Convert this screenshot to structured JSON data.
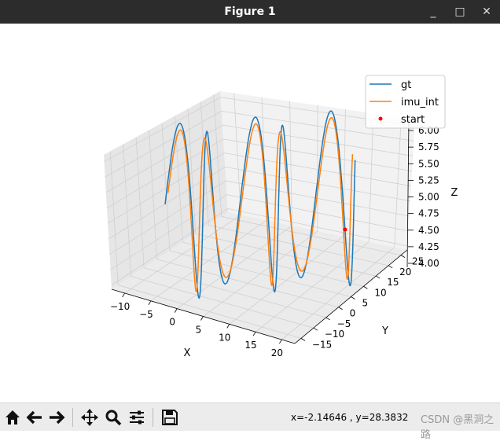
{
  "window": {
    "title": "Figure 1",
    "minimize_glyph": "_",
    "maximize_glyph": "□",
    "close_glyph": "✕"
  },
  "toolbar": {
    "buttons": [
      {
        "name": "home-icon"
      },
      {
        "name": "back-arrow-icon"
      },
      {
        "name": "forward-arrow-icon"
      },
      {
        "name": "pan-icon"
      },
      {
        "name": "zoom-icon"
      },
      {
        "name": "subplots-icon"
      },
      {
        "name": "save-icon"
      }
    ],
    "coords": "x=-2.14646    , y=28.3832",
    "watermark": "CSDN @黑洞之路"
  },
  "chart_data": {
    "type": "line3d",
    "x_ticks": [
      "−10",
      "−5",
      "0",
      "5",
      "10",
      "15",
      "20"
    ],
    "y_ticks": [
      "−15",
      "−10",
      "−5",
      "0",
      "5",
      "10",
      "15",
      "20",
      "25"
    ],
    "z_ticks": [
      "4.00",
      "4.25",
      "4.50",
      "4.75",
      "5.00",
      "5.25",
      "5.50",
      "5.75",
      "6.00"
    ],
    "xlabel": "X",
    "ylabel": "Y",
    "zlabel": "Z",
    "xlim": [
      -10,
      20
    ],
    "ylim": [
      -15,
      25
    ],
    "zlim": [
      4.0,
      6.0
    ],
    "legend": [
      {
        "label": "gt",
        "color": "#1f77b4",
        "kind": "line"
      },
      {
        "label": "imu_int",
        "color": "#ff7f0e",
        "kind": "line"
      },
      {
        "label": "start",
        "color": "#ff0000",
        "kind": "marker"
      }
    ],
    "legend_position": "top-right",
    "series": [
      {
        "name": "gt",
        "color": "#1f77b4"
      },
      {
        "name": "imu_int",
        "color": "#ff7f0e"
      },
      {
        "name": "start",
        "color": "#ff0000"
      }
    ]
  }
}
